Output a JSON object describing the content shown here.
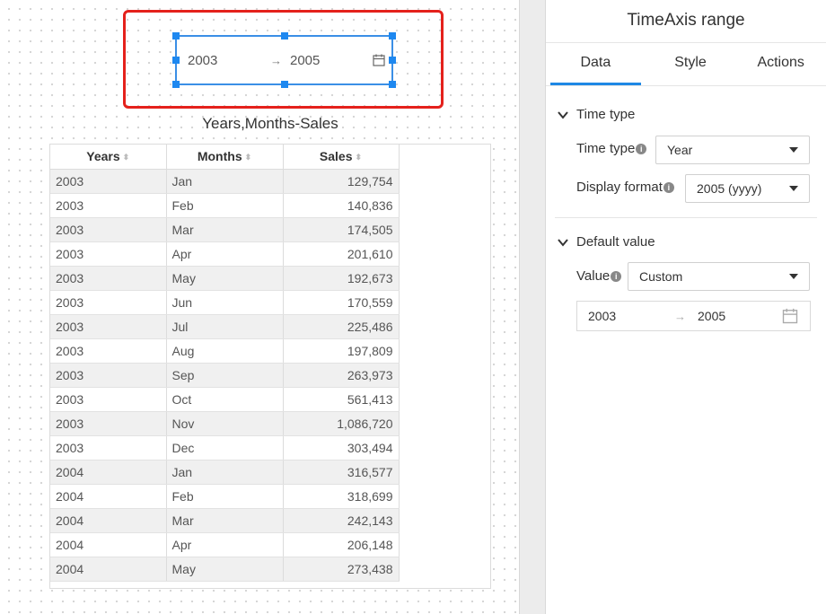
{
  "widget": {
    "from": "2003",
    "arrow": "→",
    "to": "2005",
    "icon": "calendar-icon"
  },
  "table": {
    "title": "Years,Months-Sales",
    "columns": [
      "Years",
      "Months",
      "Sales"
    ],
    "rows": [
      [
        "2003",
        "Jan",
        "129,754"
      ],
      [
        "2003",
        "Feb",
        "140,836"
      ],
      [
        "2003",
        "Mar",
        "174,505"
      ],
      [
        "2003",
        "Apr",
        "201,610"
      ],
      [
        "2003",
        "May",
        "192,673"
      ],
      [
        "2003",
        "Jun",
        "170,559"
      ],
      [
        "2003",
        "Jul",
        "225,486"
      ],
      [
        "2003",
        "Aug",
        "197,809"
      ],
      [
        "2003",
        "Sep",
        "263,973"
      ],
      [
        "2003",
        "Oct",
        "561,413"
      ],
      [
        "2003",
        "Nov",
        "1,086,720"
      ],
      [
        "2003",
        "Dec",
        "303,494"
      ],
      [
        "2004",
        "Jan",
        "316,577"
      ],
      [
        "2004",
        "Feb",
        "318,699"
      ],
      [
        "2004",
        "Mar",
        "242,143"
      ],
      [
        "2004",
        "Apr",
        "206,148"
      ],
      [
        "2004",
        "May",
        "273,438"
      ]
    ]
  },
  "panel": {
    "title": "TimeAxis range",
    "tabs": [
      "Data",
      "Style",
      "Actions"
    ],
    "active_tab": "Data",
    "time_type_section": "Time type",
    "time_type_label": "Time type",
    "time_type_value": "Year",
    "display_format_label": "Display format",
    "display_format_value": "2005 (yyyy)",
    "default_value_section": "Default value",
    "value_label": "Value",
    "value_value": "Custom",
    "range_from": "2003",
    "range_arrow": "→",
    "range_to": "2005"
  },
  "colors": {
    "selection_red": "#e4211c",
    "accent_blue": "#1e88e5"
  }
}
